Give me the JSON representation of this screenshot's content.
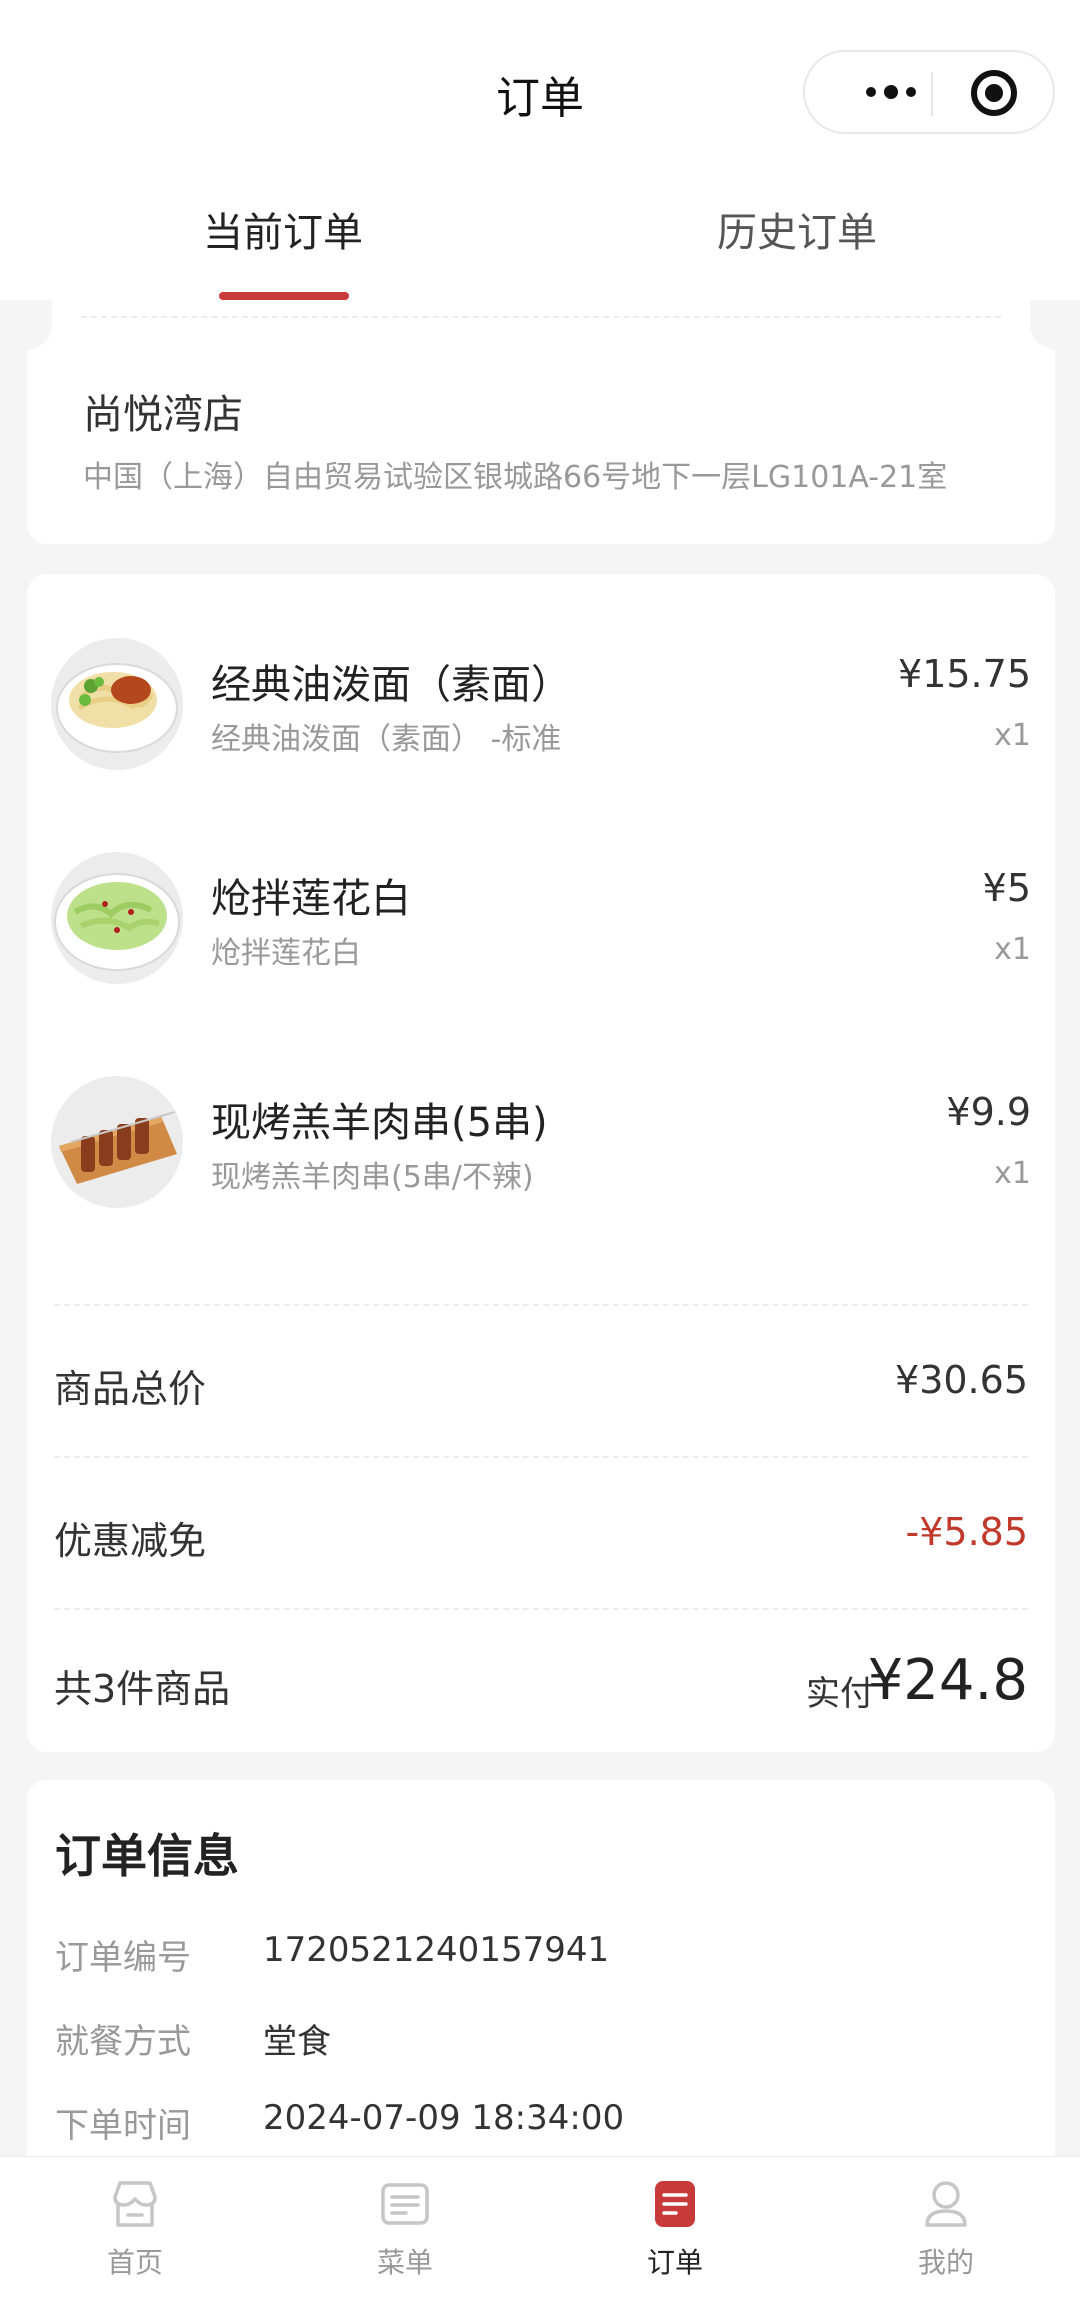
{
  "nav": {
    "title": "订单"
  },
  "tabs": {
    "current": "当前订单",
    "history": "历史订单"
  },
  "store": {
    "name": "尚悦湾店",
    "address": "中国（上海）自由贸易试验区银城路66号地下一层LG101A-21室"
  },
  "items": [
    {
      "name": "经典油泼面（素面）",
      "spec": "经典油泼面（素面） -标准",
      "price": "¥15.75",
      "qty": "x1",
      "image_icon": "noodle-bowl-icon"
    },
    {
      "name": "炝拌莲花白",
      "spec": "炝拌莲花白",
      "price": "¥5",
      "qty": "x1",
      "image_icon": "cabbage-salad-icon"
    },
    {
      "name": "现烤羔羊肉串(5串)",
      "spec": "现烤羔羊肉串(5串/不辣)",
      "price": "¥9.9",
      "qty": "x1",
      "image_icon": "lamb-skewers-icon"
    }
  ],
  "summary": {
    "subtotal_label": "商品总价",
    "subtotal_value": "¥30.65",
    "discount_label": "优惠减免",
    "discount_value": "-¥5.85",
    "count_label": "共3件商品",
    "paid_label": "实付",
    "paid_value": "¥24.8"
  },
  "order_info": {
    "title": "订单信息",
    "rows": [
      {
        "label": "订单编号",
        "value": "1720521240157941"
      },
      {
        "label": "就餐方式",
        "value": "堂食"
      },
      {
        "label": "下单时间",
        "value": "2024-07-09 18:34:00"
      }
    ]
  },
  "tabbar": [
    {
      "label": "首页",
      "icon": "store-icon",
      "active": false
    },
    {
      "label": "菜单",
      "icon": "menu-icon",
      "active": false
    },
    {
      "label": "订单",
      "icon": "order-icon",
      "active": true
    },
    {
      "label": "我的",
      "icon": "profile-icon",
      "active": false
    }
  ],
  "colors": {
    "accent": "#c8393a",
    "discount": "#c0392b",
    "background": "#f5f5f5"
  }
}
